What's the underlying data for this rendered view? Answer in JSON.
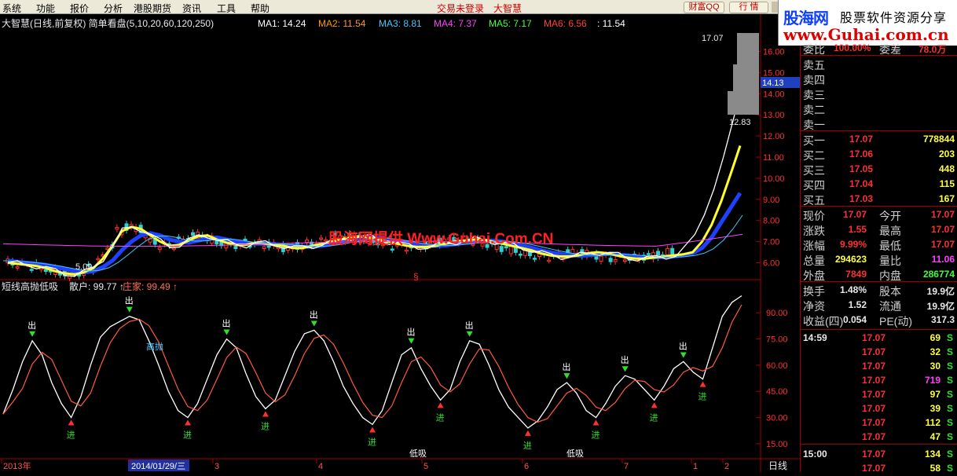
{
  "menu": {
    "items": [
      "系统",
      "功能",
      "报价",
      "分析",
      "港股期货",
      "资讯",
      "工具",
      "帮助"
    ],
    "login_status": "交易未登录",
    "brand": "大智慧",
    "buttons": [
      "财富QQ",
      "行 情"
    ]
  },
  "watermark": {
    "logo_left": "股海网",
    "logo_right": "股票软件资源分享",
    "url": "www.Guhai.com.cn",
    "overlay": "股海网提供 Www.Guhai.Com.CN"
  },
  "main_panel": {
    "title": "大智慧(日线,前复权) 简单看盘(5,10,20,60,120,250)",
    "ma_labels": [
      {
        "text": "MA1: 14.24",
        "color": "#ffffff"
      },
      {
        "text": "MA2: 11.54",
        "color": "#ff9a00"
      },
      {
        "text": "MA3: 8.81",
        "color": "#40c8ff"
      },
      {
        "text": "MA4: 7.37",
        "color": "#ff40ff"
      },
      {
        "text": "MA5: 7.17",
        "color": "#40ff40"
      },
      {
        "text": "MA6: 6.56",
        "color": "#ff4040"
      },
      {
        "text": ": 11.54",
        "color": "#ffffff"
      }
    ],
    "price_axis": [
      "16.00",
      "15.00",
      "14.00",
      "13.00",
      "12.00",
      "11.00",
      "10.00",
      "9.00",
      "8.00",
      "7.00",
      "6.00"
    ],
    "current_price_tag": "14.13",
    "high_label": "17.07",
    "low_label_right": "12.83",
    "low_label_left": "5.09",
    "marker_symbol": "§"
  },
  "indicator_panel": {
    "title": "短线高抛低吸",
    "retail": "散户: 99.77 ↑",
    "dealer": "庄家: 99.49 ↑",
    "axis": [
      "90.00",
      "75.00",
      "60.00",
      "45.00",
      "30.00",
      "15.00"
    ],
    "text_buy": "进",
    "text_sell": "出",
    "text_high": "高抛",
    "text_low": "低吸"
  },
  "date_axis": {
    "labels": [
      "2013年",
      "2014/01/29/三",
      "3",
      "4",
      "5",
      "6",
      "7",
      "1",
      "2"
    ],
    "period": "日线"
  },
  "quote": {
    "partial_top": {
      "label_a": "委比",
      "value_a": "100.00%",
      "label_b": "委差",
      "value_b": "78.0万"
    },
    "asks": [
      "卖五",
      "卖四",
      "卖三",
      "卖二",
      "卖一"
    ],
    "bids": [
      {
        "label": "买一",
        "price": "17.07",
        "vol": "778844"
      },
      {
        "label": "买二",
        "price": "17.06",
        "vol": "203"
      },
      {
        "label": "买三",
        "price": "17.05",
        "vol": "448"
      },
      {
        "label": "买四",
        "price": "17.04",
        "vol": "115"
      },
      {
        "label": "买五",
        "price": "17.03",
        "vol": "167"
      }
    ],
    "stats": [
      {
        "l1": "现价",
        "v1": "17.07",
        "c1": "#ff3030",
        "l2": "今开",
        "v2": "17.07",
        "c2": "#ff3030"
      },
      {
        "l1": "涨跌",
        "v1": "1.55",
        "c1": "#ff3030",
        "l2": "最高",
        "v2": "17.07",
        "c2": "#ff3030"
      },
      {
        "l1": "涨幅",
        "v1": "9.99%",
        "c1": "#ff3030",
        "l2": "最低",
        "v2": "17.07",
        "c2": "#ff3030"
      },
      {
        "l1": "总量",
        "v1": "294623",
        "c1": "#ffff40",
        "l2": "量比",
        "v2": "11.06",
        "c2": "#ff40ff"
      },
      {
        "l1": "外盘",
        "v1": "7849",
        "c1": "#ff3030",
        "l2": "内盘",
        "v2": "286774",
        "c2": "#40ff40"
      }
    ],
    "fund": [
      {
        "l1": "换手",
        "v1": "1.48%",
        "l2": "股本",
        "v2": "19.9亿"
      },
      {
        "l1": "净资",
        "v1": "1.52",
        "l2": "流通",
        "v2": "19.9亿"
      },
      {
        "l1": "收益(四)",
        "v1": "0.054",
        "l2": "PE(动)",
        "v2": "317.3"
      }
    ],
    "ticks": [
      {
        "time": "14:59",
        "price": "17.07",
        "vol": "69",
        "side": "S",
        "vc": "#ffff40"
      },
      {
        "time": "",
        "price": "17.07",
        "vol": "32",
        "side": "S",
        "vc": "#ffff40"
      },
      {
        "time": "",
        "price": "17.07",
        "vol": "30",
        "side": "S",
        "vc": "#ffff40"
      },
      {
        "time": "",
        "price": "17.07",
        "vol": "719",
        "side": "S",
        "vc": "#ff40ff"
      },
      {
        "time": "",
        "price": "17.07",
        "vol": "97",
        "side": "S",
        "vc": "#ffff40"
      },
      {
        "time": "",
        "price": "17.07",
        "vol": "39",
        "side": "S",
        "vc": "#ffff40"
      },
      {
        "time": "",
        "price": "17.07",
        "vol": "112",
        "side": "S",
        "vc": "#ffff40"
      },
      {
        "time": "",
        "price": "17.07",
        "vol": "47",
        "side": "S",
        "vc": "#ffff40"
      },
      {
        "time": "15:00",
        "price": "17.07",
        "vol": "134",
        "side": "S",
        "vc": "#ffff40"
      },
      {
        "time": "",
        "price": "17.07",
        "vol": "58",
        "side": "S",
        "vc": "#ffff40"
      }
    ]
  },
  "chart_data": {
    "type": "line",
    "price_range": [
      5.5,
      16.8
    ],
    "indicator_range": [
      10,
      100
    ],
    "ma5": [
      6.0,
      5.95,
      5.9,
      5.85,
      5.75,
      5.6,
      5.5,
      5.45,
      5.55,
      5.75,
      6.2,
      6.8,
      7.5,
      7.7,
      7.6,
      7.3,
      7.0,
      6.8,
      6.85,
      7.05,
      7.25,
      7.3,
      7.1,
      6.95,
      6.85,
      6.85,
      6.95,
      6.9,
      6.85,
      6.8,
      6.7,
      6.7,
      6.8,
      6.9,
      7.0,
      7.1,
      7.2,
      7.25,
      7.2,
      7.1,
      7.0,
      6.9,
      6.8,
      6.75,
      6.75,
      6.8,
      6.9,
      7.0,
      7.05,
      7.1,
      7.1,
      7.0,
      6.9,
      6.8,
      6.7,
      6.6,
      6.45,
      6.35,
      6.3,
      6.3,
      6.35,
      6.45,
      6.5,
      6.45,
      6.35,
      6.25,
      6.2,
      6.2,
      6.25,
      6.3,
      6.35,
      6.4,
      6.5,
      7.0,
      7.8,
      8.9,
      10.2,
      11.54
    ],
    "ma10": [
      6.1,
      6.05,
      6.0,
      5.95,
      5.9,
      5.8,
      5.7,
      5.6,
      5.55,
      5.6,
      5.8,
      6.1,
      6.6,
      7.0,
      7.3,
      7.4,
      7.3,
      7.1,
      7.0,
      6.95,
      7.05,
      7.15,
      7.2,
      7.1,
      7.0,
      6.92,
      6.9,
      6.9,
      6.88,
      6.85,
      6.8,
      6.76,
      6.76,
      6.8,
      6.88,
      6.98,
      7.08,
      7.15,
      7.2,
      7.18,
      7.1,
      7.0,
      6.92,
      6.85,
      6.8,
      6.8,
      6.82,
      6.88,
      6.95,
      7.0,
      7.05,
      7.05,
      7.0,
      6.92,
      6.82,
      6.72,
      6.6,
      6.5,
      6.42,
      6.36,
      6.33,
      6.35,
      6.4,
      6.42,
      6.4,
      6.35,
      6.3,
      6.26,
      6.25,
      6.27,
      6.3,
      6.35,
      6.45,
      6.7,
      7.2,
      7.9,
      8.6,
      9.3
    ],
    "indicator": [
      32,
      46,
      62,
      74,
      66,
      50,
      38,
      30,
      42,
      60,
      76,
      82,
      85,
      88,
      86,
      74,
      60,
      45,
      34,
      30,
      38,
      52,
      66,
      75,
      70,
      55,
      42,
      35,
      40,
      54,
      68,
      78,
      80,
      74,
      62,
      48,
      38,
      30,
      26,
      34,
      50,
      66,
      70,
      58,
      48,
      40,
      46,
      62,
      74,
      72,
      60,
      46,
      36,
      30,
      24,
      28,
      36,
      46,
      50,
      44,
      34,
      30,
      38,
      48,
      54,
      52,
      46,
      40,
      48,
      58,
      62,
      56,
      52,
      70,
      88,
      96,
      99.77
    ]
  }
}
